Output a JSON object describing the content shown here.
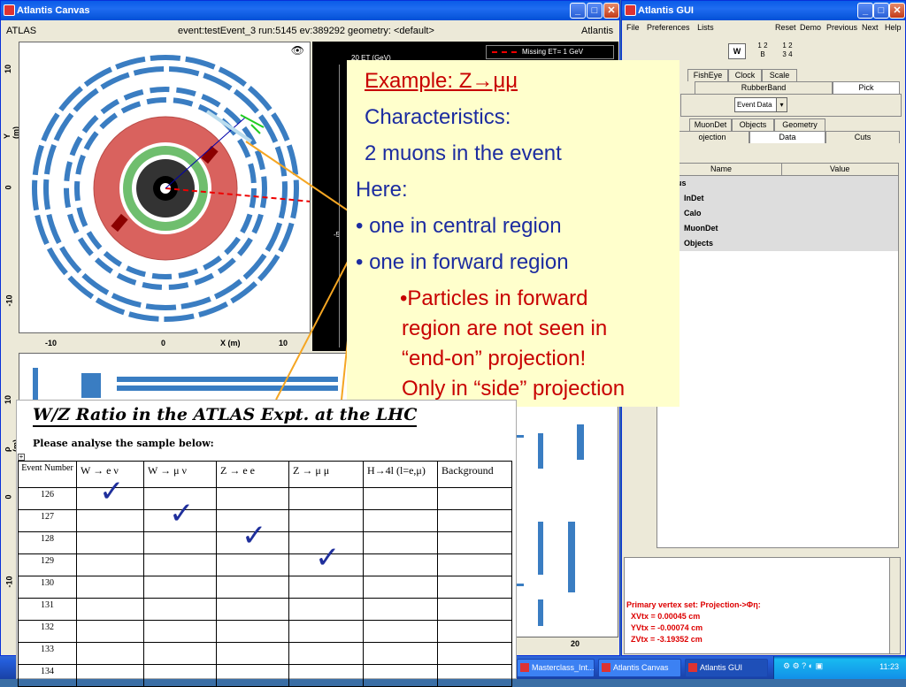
{
  "canvas_window": {
    "title": "Atlantis Canvas",
    "header_left": "ATLAS",
    "header_center": "event:testEvent_3 run:5145 ev:389292  geometry: <default>",
    "header_right": "Atlantis",
    "yx_axis": {
      "ylabel": "Y (m)",
      "xlabel": "X (m)",
      "xticks": [
        "-10",
        "0",
        "10"
      ],
      "yticks": [
        "10",
        "0",
        "-10"
      ]
    },
    "etphi_legend": "Missing ET= 1 GeV",
    "etphi_label": "20 ET (GeV)",
    "etphi_tick": "-5",
    "rz_axis": {
      "ylabel": "ρ (m)",
      "yticks": [
        "10",
        "0",
        "-10"
      ],
      "xtick": "20"
    }
  },
  "gui_window": {
    "title": "Atlantis GUI",
    "menu": [
      "File",
      "Preferences",
      "Lists"
    ],
    "menu_right": [
      "Reset",
      "Demo",
      "Previous",
      "Next",
      "Help"
    ],
    "layout_buttons": {
      "w": "W",
      "grid1": [
        "1",
        "2",
        "B"
      ],
      "grid2": [
        "1",
        "2",
        "3",
        "4"
      ]
    },
    "tabs_row1": [
      "FishEye",
      "Clock",
      "Scale"
    ],
    "tabs_row2": [
      "RubberBand",
      "Pick"
    ],
    "event_data_select": "Event Data",
    "tabs_row3": [
      "MuonDet",
      "Objects",
      "Geometry"
    ],
    "tabs_row4": [
      "ojection",
      "Data",
      "Cuts"
    ],
    "tree_headers": [
      "Name",
      "Value"
    ],
    "tree_items": [
      "atus",
      "InDet",
      "Calo",
      "MuonDet",
      "Objects"
    ],
    "output_lines": [
      "Primary vertex set: Projection->Φη:",
      "  XVtx = 0.00045 cm",
      "  YVtx = -0.00074 cm",
      "  ZVtx = -3.19352 cm"
    ]
  },
  "taskbar": {
    "tasks": [
      "Masterclass_Int...",
      "Atlantis Canvas",
      "Atlantis GUI"
    ],
    "clock": "11:23"
  },
  "callout": {
    "title": "Example: Z→μμ",
    "line1": "Characteristics:",
    "line2": "2 muons in the event",
    "line3": "Here:",
    "bullet1": "• one in central region",
    "bullet2": "• one in forward region",
    "sub1": "•Particles in forward",
    "sub2": "region are not seen in",
    "sub3": "“end-on” projection!",
    "sub4": "Only in “side” projection"
  },
  "worksheet": {
    "title": "W/Z Ratio in the ATLAS Expt. at the LHC",
    "subtitle": "Please analyse the sample below:",
    "columns": [
      "Event Number",
      "W → e ν",
      "W → μ ν",
      "Z → e e",
      "Z → μ μ",
      "H→4l (l=e,μ)",
      "Background"
    ],
    "rows": [
      "126",
      "127",
      "128",
      "129",
      "130",
      "131",
      "132",
      "133",
      "134"
    ],
    "checks": [
      {
        "event": "126",
        "column": "W → e ν"
      },
      {
        "event": "127",
        "column": "W → μ ν"
      },
      {
        "event": "128",
        "column": "Z → e e"
      },
      {
        "event": "129",
        "column": "Z → μ μ"
      }
    ],
    "check_glyph": "✓",
    "colors": {
      "check": "#1f2f9c"
    }
  },
  "colors": {
    "callout_text": "#1c2ca0",
    "callout_red": "#c80000",
    "callout_bg": "#ffffcc"
  }
}
